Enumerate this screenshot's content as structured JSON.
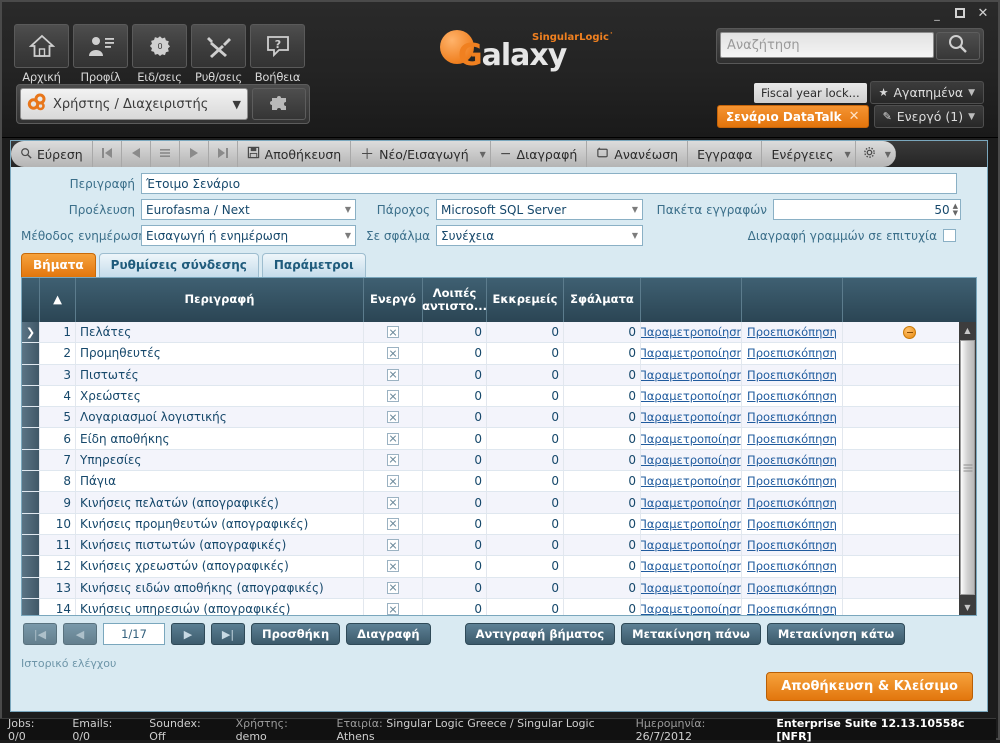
{
  "header": {
    "window_controls": {
      "minimize": "–",
      "maximize": "□",
      "close": "✕"
    },
    "quick_buttons": [
      {
        "label": "Αρχική",
        "icon": "home-icon"
      },
      {
        "label": "Προφίλ",
        "icon": "profile-icon"
      },
      {
        "label": "Ειδ/σεις",
        "icon": "notifications-icon",
        "badge": "0"
      },
      {
        "label": "Ρυθ/σεις",
        "icon": "tools-icon"
      },
      {
        "label": "Βοήθεια",
        "icon": "help-icon"
      }
    ],
    "user_selector": {
      "value": "Χρήστης / Διαχειριστής",
      "icon": "gears-icon",
      "caret": "▼"
    },
    "extra_button_icon": "puzzle-icon",
    "logo": {
      "word_first": "G",
      "word_rest": "alaxy",
      "brand": "SingularLogic˙"
    },
    "search": {
      "placeholder": "Αναζήτηση",
      "value": "",
      "button_icon": "search-icon"
    },
    "fiscal_lock_label": "Fiscal year lock...",
    "favorites_label": "Αγαπημένα",
    "scenario_tag": {
      "label": "Σενάριο DataTalk",
      "close": "✕"
    },
    "active_label": "Ενεργό (1)"
  },
  "toolbar": {
    "items": [
      {
        "name": "find",
        "label": "Εύρεση",
        "icon": "search-icon"
      },
      {
        "name": "first",
        "label": "",
        "icon": "first-record-icon"
      },
      {
        "name": "prev",
        "label": "",
        "icon": "prev-record-icon"
      },
      {
        "name": "list",
        "label": "",
        "icon": "list-icon"
      },
      {
        "name": "next",
        "label": "",
        "icon": "next-record-icon"
      },
      {
        "name": "last",
        "label": "",
        "icon": "last-record-icon"
      },
      {
        "name": "save",
        "label": "Αποθήκευση",
        "icon": "save-icon"
      },
      {
        "name": "new",
        "label": "Νέο/Εισαγωγή",
        "icon": "plus-icon",
        "has_caret": true
      },
      {
        "name": "delete",
        "label": "Διαγραφή",
        "icon": "minus-icon"
      },
      {
        "name": "refresh",
        "label": "Ανανέωση",
        "icon": "refresh-icon"
      },
      {
        "name": "documents",
        "label": "Εγγραφα",
        "icon": ""
      },
      {
        "name": "actions",
        "label": "Ενέργειες",
        "icon": "",
        "has_caret": true
      },
      {
        "name": "settings",
        "label": "",
        "icon": "gear-icon",
        "has_caret": true
      }
    ]
  },
  "form": {
    "description": {
      "label": "Περιγραφή",
      "value": "Έτοιμο Σενάριο"
    },
    "origin": {
      "label": "Προέλευση",
      "value": "Eurofasma / Next"
    },
    "provider": {
      "label": "Πάροχος",
      "value": "Microsoft SQL Server"
    },
    "record_packets": {
      "label": "Πακέτα εγγραφών",
      "value": "50"
    },
    "update_method": {
      "label": "Μέθοδος ενημέρωσης",
      "value": "Εισαγωγή ή ενημέρωση"
    },
    "on_error": {
      "label": "Σε σφάλμα",
      "value": "Συνέχεια"
    },
    "delete_rows_on_success": {
      "label": "Διαγραφή γραμμών σε επιτυχία",
      "checked": false
    }
  },
  "tabs": [
    {
      "label": "Βήματα",
      "active": true
    },
    {
      "label": "Ρυθμίσεις σύνδεσης",
      "active": false
    },
    {
      "label": "Παράμετροι",
      "active": false
    }
  ],
  "grid": {
    "columns": [
      {
        "key": "marker",
        "label": ""
      },
      {
        "key": "sort",
        "label": "▲"
      },
      {
        "key": "description",
        "label": "Περιγραφή"
      },
      {
        "key": "active",
        "label": "Ενεργό"
      },
      {
        "key": "remaining",
        "label": "Λοιπές αντιστο..."
      },
      {
        "key": "pending",
        "label": "Εκκρεμείς"
      },
      {
        "key": "errors",
        "label": "Σφάλματα"
      },
      {
        "key": "customize",
        "label": ""
      },
      {
        "key": "preview",
        "label": ""
      },
      {
        "key": "badge",
        "label": ""
      }
    ],
    "link_customize": "Παραμετροποίηση",
    "link_preview": "Προεπισκόπηση",
    "rows": [
      {
        "n": "1",
        "description": "Πελάτες",
        "active": true,
        "remaining": "0",
        "pending": "0",
        "errors": "0",
        "selected": true,
        "badge": true
      },
      {
        "n": "2",
        "description": "Προμηθευτές",
        "active": true,
        "remaining": "0",
        "pending": "0",
        "errors": "0",
        "selected": false,
        "badge": false
      },
      {
        "n": "3",
        "description": "Πιστωτές",
        "active": true,
        "remaining": "0",
        "pending": "0",
        "errors": "0",
        "selected": false,
        "badge": false
      },
      {
        "n": "4",
        "description": "Χρεώστες",
        "active": true,
        "remaining": "0",
        "pending": "0",
        "errors": "0",
        "selected": false,
        "badge": false
      },
      {
        "n": "5",
        "description": "Λογαριασμοί λογιστικής",
        "active": true,
        "remaining": "0",
        "pending": "0",
        "errors": "0",
        "selected": false,
        "badge": false
      },
      {
        "n": "6",
        "description": "Είδη αποθήκης",
        "active": true,
        "remaining": "0",
        "pending": "0",
        "errors": "0",
        "selected": false,
        "badge": false
      },
      {
        "n": "7",
        "description": "Υπηρεσίες",
        "active": true,
        "remaining": "0",
        "pending": "0",
        "errors": "0",
        "selected": false,
        "badge": false
      },
      {
        "n": "8",
        "description": "Πάγια",
        "active": true,
        "remaining": "0",
        "pending": "0",
        "errors": "0",
        "selected": false,
        "badge": false
      },
      {
        "n": "9",
        "description": "Κινήσεις πελατών (απογραφικές)",
        "active": true,
        "remaining": "0",
        "pending": "0",
        "errors": "0",
        "selected": false,
        "badge": false
      },
      {
        "n": "10",
        "description": "Κινήσεις προμηθευτών (απογραφικές)",
        "active": true,
        "remaining": "0",
        "pending": "0",
        "errors": "0",
        "selected": false,
        "badge": false
      },
      {
        "n": "11",
        "description": "Κινήσεις πιστωτών (απογραφικές)",
        "active": true,
        "remaining": "0",
        "pending": "0",
        "errors": "0",
        "selected": false,
        "badge": false
      },
      {
        "n": "12",
        "description": "Κινήσεις χρεωστών (απογραφικές)",
        "active": true,
        "remaining": "0",
        "pending": "0",
        "errors": "0",
        "selected": false,
        "badge": false
      },
      {
        "n": "13",
        "description": "Κινήσεις ειδών αποθήκης (απογραφικές)",
        "active": true,
        "remaining": "0",
        "pending": "0",
        "errors": "0",
        "selected": false,
        "badge": false
      },
      {
        "n": "14",
        "description": "Κινήσεις υπηρεσιών (απογραφικές)",
        "active": true,
        "remaining": "0",
        "pending": "0",
        "errors": "0",
        "selected": false,
        "badge": false
      }
    ]
  },
  "grid_footer": {
    "first_icon": "first-page-icon",
    "prev_icon": "prev-page-icon",
    "page_value": "1/17",
    "next_icon": "next-page-icon",
    "last_icon": "last-page-icon",
    "add_label": "Προσθήκη",
    "delete_label": "Διαγραφή",
    "copy_step_label": "Αντιγραφή βήματος",
    "move_up_label": "Μετακίνηση πάνω",
    "move_down_label": "Μετακίνηση κάτω"
  },
  "audit_label": "Ιστορικό ελέγχου",
  "save_close_label": "Αποθήκευση & Κλείσιμο",
  "statusbar": {
    "jobs": "Jobs: 0/0",
    "emails": "Emails: 0/0",
    "soundex": "Soundex: Off",
    "user_label": "Χρήστης:",
    "user_value": "demo",
    "company_label": "Εταιρία:",
    "company_value": "Singular Logic Greece / Singular Logic Athens",
    "date_label": "Ημερομηνία:",
    "date_value": "26/7/2012",
    "version": "Enterprise Suite  12.13.10558c [NFR]"
  },
  "colors": {
    "accent_orange": "#e2760d",
    "header_dark": "#232323",
    "panel_blue": "#d9eaf2",
    "grid_header": "#2b4554",
    "link_blue": "#1f5b9e"
  }
}
